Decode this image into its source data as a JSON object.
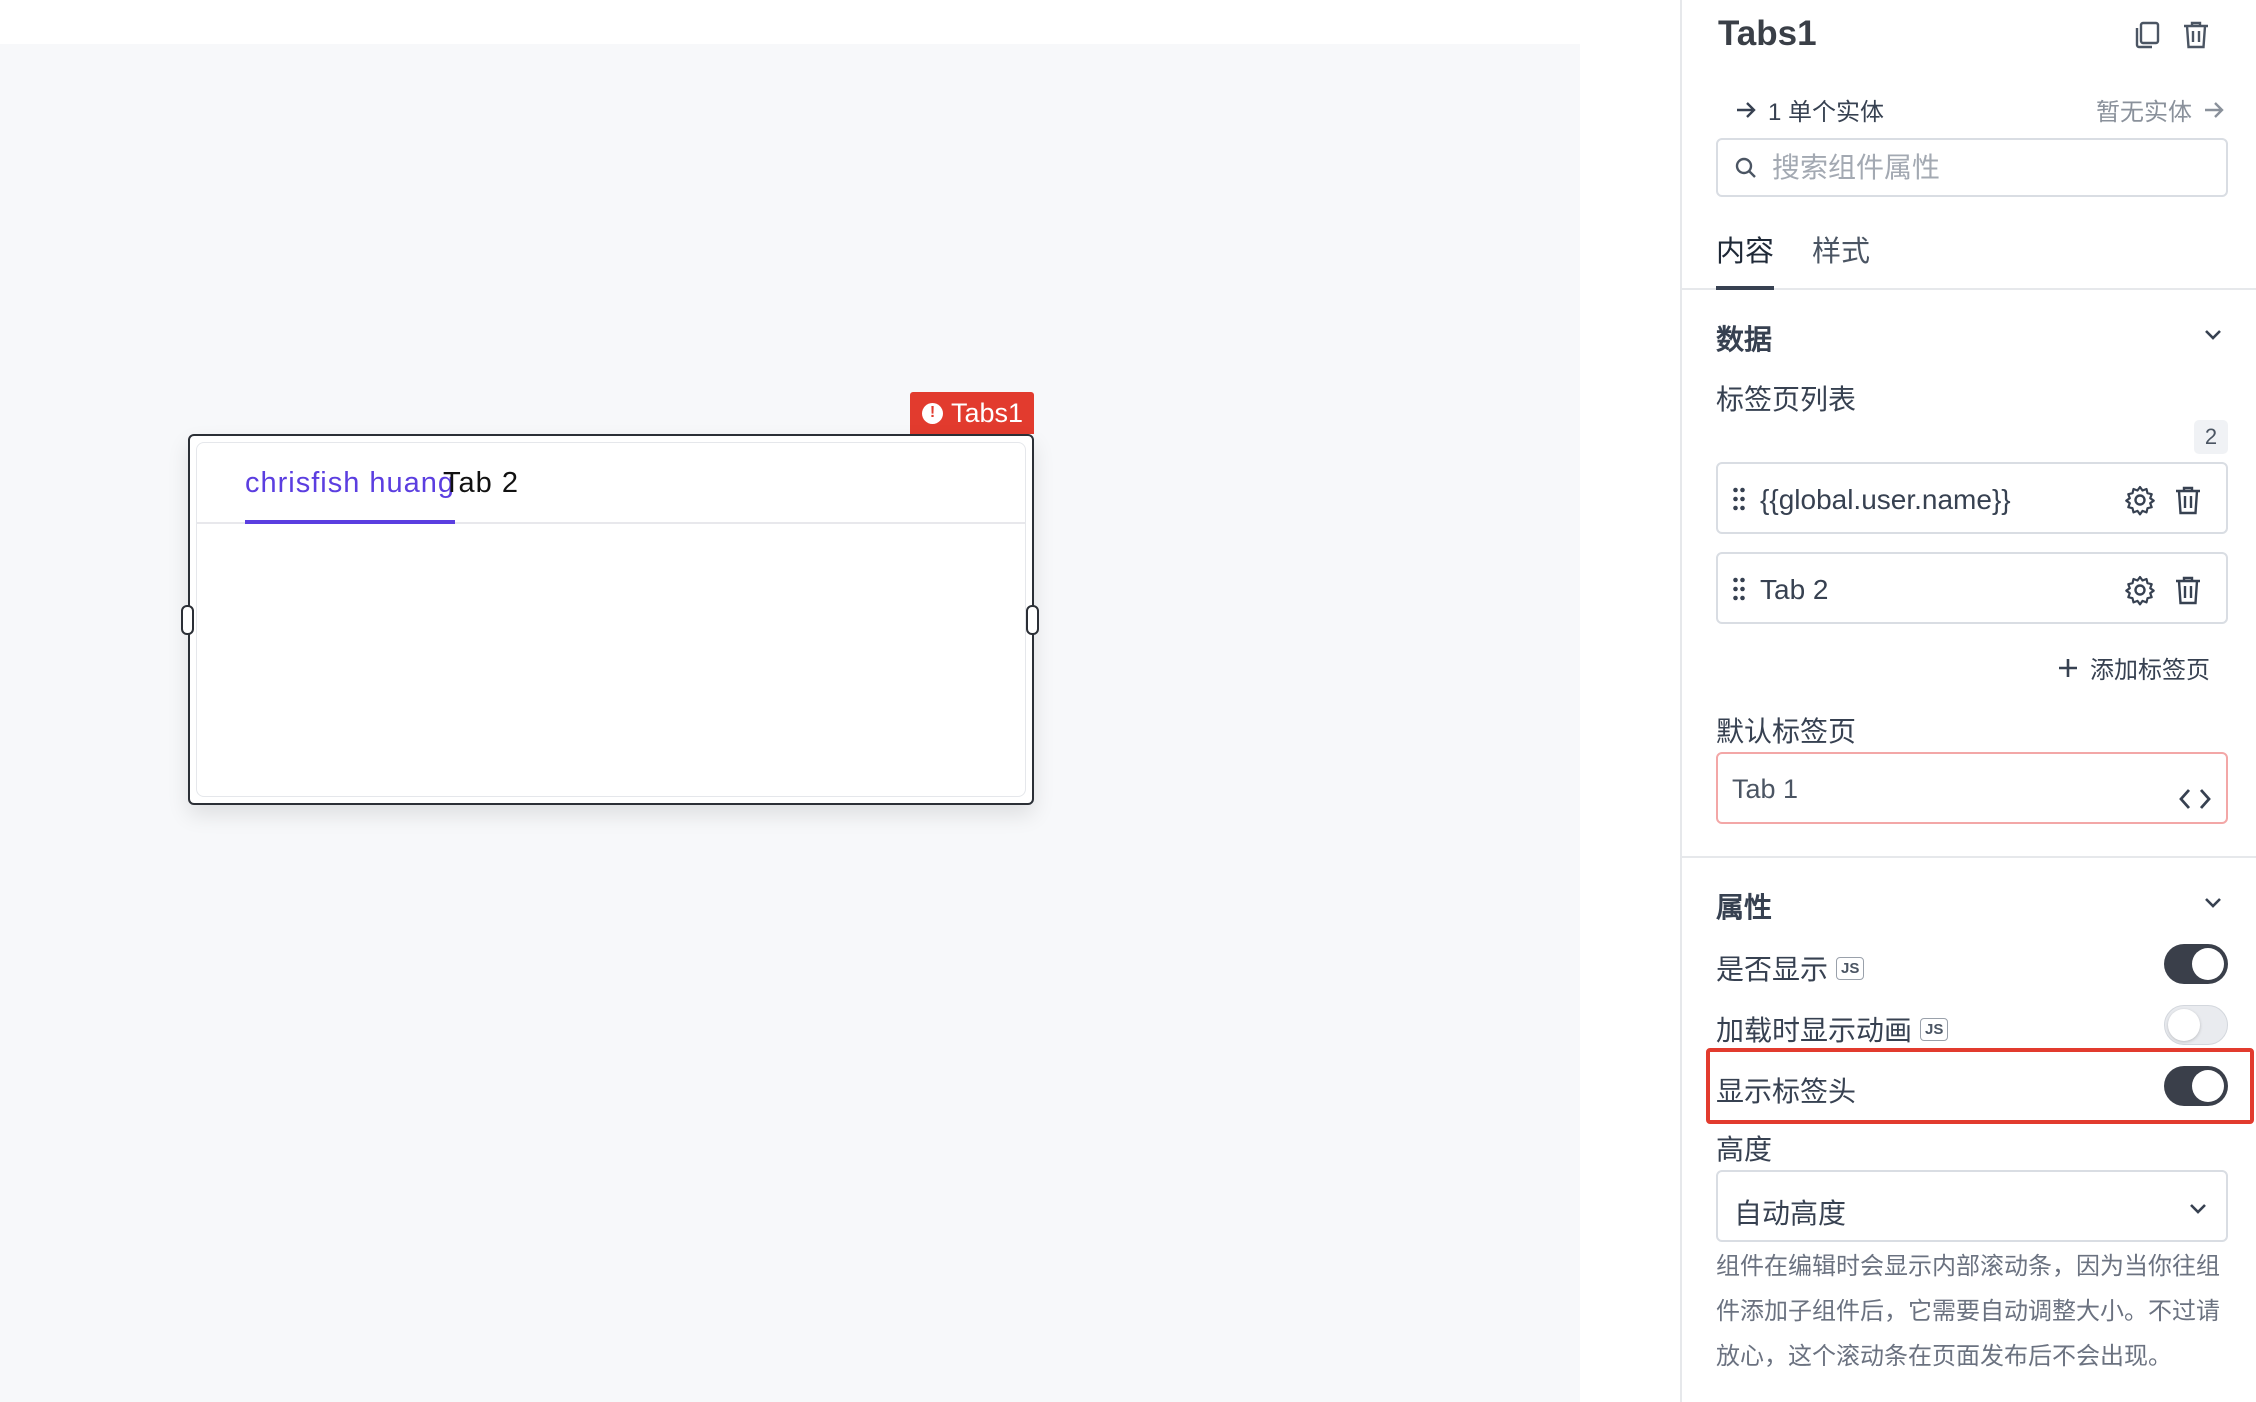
{
  "canvas": {
    "component_label": "Tabs1",
    "tabs": [
      {
        "label": "chrisfish huang",
        "active": true
      },
      {
        "label": "Tab 2",
        "active": false
      }
    ]
  },
  "panel": {
    "title": "Tabs1",
    "entity_left": "1 单个实体",
    "entity_right": "暂无实体",
    "search_placeholder": "搜索组件属性",
    "tabs": [
      {
        "label": "内容",
        "active": true
      },
      {
        "label": "样式",
        "active": false
      }
    ],
    "data_section": {
      "title": "数据",
      "tab_list_label": "标签页列表",
      "tab_count": "2",
      "items": [
        {
          "label": "{{global.user.name}}"
        },
        {
          "label": "Tab 2"
        }
      ],
      "add_tab_label": "添加标签页",
      "default_tab_label": "默认标签页",
      "default_tab_value": "Tab 1"
    },
    "props_section": {
      "title": "属性",
      "rows": [
        {
          "label": "是否显示",
          "js": "JS",
          "on": true
        },
        {
          "label": "加载时显示动画",
          "js": "JS",
          "on": false
        },
        {
          "label": "显示标签头",
          "js": "",
          "on": true
        }
      ],
      "height_label": "高度",
      "height_value": "自动高度",
      "note": "组件在编辑时会显示内部滚动条，因为当你往组件添加子组件后，它需要自动调整大小。不过请放心，这个滚动条在页面发布后不会出现。"
    }
  },
  "colors": {
    "accent": "#5b3ee0",
    "error": "#e23b2e",
    "toggle_on": "#3a3f4a"
  }
}
